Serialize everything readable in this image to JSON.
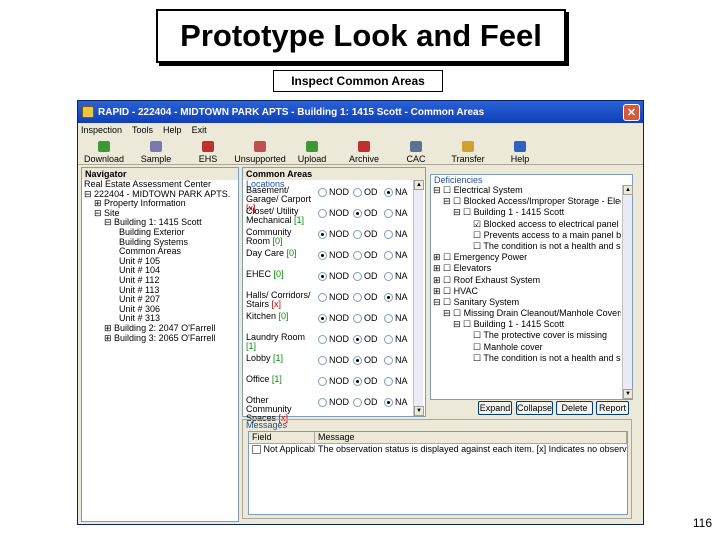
{
  "slide": {
    "title": "Prototype Look and Feel",
    "subtitle": "Inspect Common Areas",
    "page_number": "116"
  },
  "window": {
    "title": "RAPID - 222404 - MIDTOWN PARK APTS - Building 1: 1415 Scott - Common Areas",
    "close_label": "✕"
  },
  "menu": [
    "Inspection",
    "Tools",
    "Help",
    "Exit"
  ],
  "toolbar": [
    {
      "label": "Download",
      "icon": "download-icon",
      "color": "#3a9a3a"
    },
    {
      "label": "Sample",
      "icon": "sample-icon",
      "color": "#7a7ab0"
    },
    {
      "label": "EHS",
      "icon": "ehs-icon",
      "color": "#c03030"
    },
    {
      "label": "Unsupported",
      "icon": "unsupported-icon",
      "color": "#c05050"
    },
    {
      "label": "Upload",
      "icon": "upload-icon",
      "color": "#3a9a3a"
    },
    {
      "label": "Archive",
      "icon": "archive-icon",
      "color": "#c03030"
    },
    {
      "label": "CAC",
      "icon": "cac-icon",
      "color": "#607090"
    },
    {
      "label": "Transfer",
      "icon": "transfer-icon",
      "color": "#d0a030"
    },
    {
      "label": "Help",
      "icon": "help-icon",
      "color": "#3060c0"
    }
  ],
  "navigator": {
    "header": "Navigator",
    "items": [
      "Real Estate Assessment Center",
      "⊟ 222404 - MIDTOWN PARK APTS.",
      "    ⊞ Property Information",
      "    ⊟ Site",
      "        ⊟ Building 1: 1415 Scott",
      "              Building Exterior",
      "              Building Systems",
      "              Common Areas",
      "              Unit # 105",
      "              Unit # 104",
      "              Unit # 112",
      "              Unit # 113",
      "              Unit # 207",
      "              Unit # 306",
      "              Unit # 313",
      "        ⊞ Building 2: 2047 O'Farrell",
      "        ⊞ Building 3: 2065 O'Farrell"
    ]
  },
  "common_areas": {
    "header": "Common Areas",
    "group_label": "Locations",
    "options": [
      "NOD",
      "OD",
      "NA"
    ],
    "rows": [
      {
        "label": "Basement/ Garage/ Carport",
        "count": "[x]",
        "count_red": true,
        "selected": 2
      },
      {
        "label": "Closet/ Utility Mechanical",
        "count": "[1]",
        "count_red": false,
        "selected": 1
      },
      {
        "label": "Community Room",
        "count": "[0]",
        "count_red": false,
        "selected": 0
      },
      {
        "label": "Day Care",
        "count": "[0]",
        "count_red": false,
        "selected": 0
      },
      {
        "label": "EHEC",
        "count": "[0]",
        "count_red": false,
        "selected": 0
      },
      {
        "label": "Halls/ Corridors/ Stairs",
        "count": "[x]",
        "count_red": true,
        "selected": 2
      },
      {
        "label": "Kitchen",
        "count": "[0]",
        "count_red": false,
        "selected": 0
      },
      {
        "label": "Laundry Room",
        "count": "[1]",
        "count_red": false,
        "selected": 1
      },
      {
        "label": "Lobby",
        "count": "[1]",
        "count_red": false,
        "selected": 1
      },
      {
        "label": "Office",
        "count": "[1]",
        "count_red": false,
        "selected": 1
      },
      {
        "label": "Other Community Spaces",
        "count": "[x]",
        "count_red": true,
        "selected": 2
      }
    ]
  },
  "deficiencies": {
    "group_label": "Deficiencies",
    "items": [
      "⊟ ☐ Electrical System",
      "    ⊟ ☐ Blocked Access/Improper Storage - Electrical",
      "        ⊟ ☐ Building 1 - 1415 Scott",
      "                ☑ Blocked access to electrical panel",
      "                ☐ Prevents access to a main panel board",
      "                ☐ The condition is not a health and safe",
      "⊞ ☐ Emergency Power",
      "⊞ ☐ Elevators",
      "⊞ ☐ Roof Exhaust System",
      "⊞ ☐ HVAC",
      "⊟ ☐ Sanitary System",
      "    ⊟ ☐ Missing Drain Cleanout/Manhole Covers",
      "        ⊟ ☐ Building 1 - 1415 Scott",
      "                ☐ The protective cover is missing",
      "                ☐ Manhole cover",
      "                ☐ The condition is not a health and safe"
    ],
    "buttons": [
      "Expand",
      "Collapse",
      "Delete",
      "Report"
    ]
  },
  "messages": {
    "group_label": "Messages",
    "columns": [
      "Field",
      "Message"
    ],
    "rows": [
      {
        "field": "Not Applicable",
        "message": "The observation status is displayed against each item. [x] Indicates no observations (C..."
      }
    ]
  }
}
